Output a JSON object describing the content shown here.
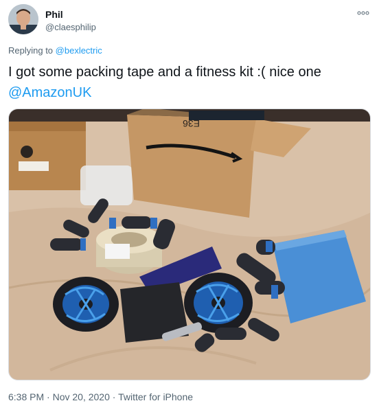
{
  "author": {
    "name": "Phil",
    "handle": "@claesphilip"
  },
  "reply": {
    "prefix": "Replying to ",
    "to": "@bexlectric"
  },
  "tweet": {
    "text_before": "I got some packing tape and a fitness kit :( nice one",
    "mention": "@AmazonUK"
  },
  "photo": {
    "box_label": "E36"
  },
  "meta": {
    "time": "6:38 PM",
    "sep1": " · ",
    "date": "Nov 20, 2020",
    "sep2": " · ",
    "source": "Twitter for iPhone"
  },
  "icons": {
    "more": "more-dots-icon"
  },
  "colors": {
    "link": "#1d9bf0",
    "secondary": "#536471",
    "text": "#0f1419"
  }
}
